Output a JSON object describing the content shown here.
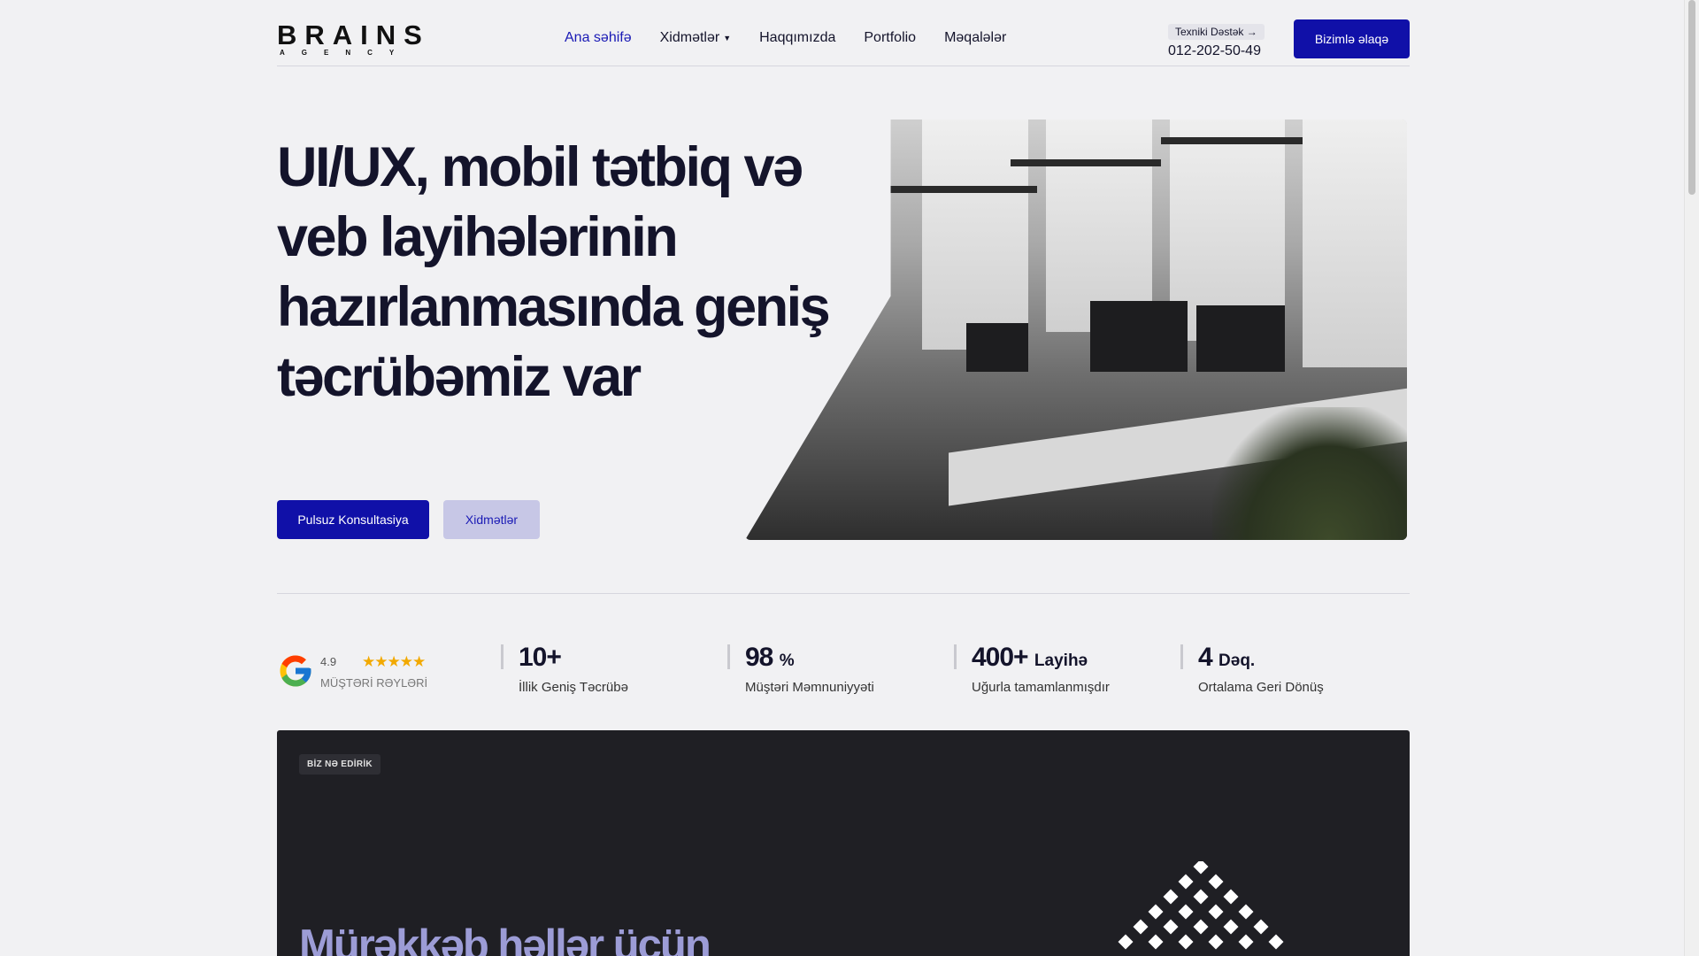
{
  "header": {
    "logo_main": "BRAINS",
    "logo_sub": "AGENCY",
    "nav": [
      {
        "label": "Ana səhifə",
        "active": true
      },
      {
        "label": "Xidmətlər",
        "dropdown": true
      },
      {
        "label": "Haqqımızda"
      },
      {
        "label": "Portfolio"
      },
      {
        "label": "Məqalələr"
      }
    ],
    "support_link": "Texniki Dəstək →",
    "support_phone": "012-202-50-49",
    "contact_button": "Bizimlə əlaqə"
  },
  "hero": {
    "title": "UI/UX, mobil tətbiq və veb layihələrinin hazırlanmasında geniş təcrübəmiz var",
    "primary_button": "Pulsuz Konsultasiya",
    "secondary_button": "Xidmətlər"
  },
  "stats": {
    "rating_value": "4.9",
    "stars": "★★★★★",
    "rating_label": "MÜŞTƏRİ RƏYLƏRİ",
    "items": [
      {
        "value": "10+",
        "unit": "",
        "label": "İllik Geniş Təcrübə"
      },
      {
        "value": "98",
        "unit": "%",
        "label": "Müştəri Məmnuniyyəti"
      },
      {
        "value": "400+",
        "unit": "Layihə",
        "label": "Uğurla tamamlanmışdır"
      },
      {
        "value": "4",
        "unit": "Dəq.",
        "label": "Ortalama Geri Dönüş"
      }
    ]
  },
  "section": {
    "badge": "BİZ NƏ EDİRİK",
    "title": "Mürəkkəb həllər üçün"
  },
  "colors": {
    "brand": "#1010a8",
    "background": "#f1f1f3",
    "dark_section": "#1f1f24",
    "star": "#f2a900"
  }
}
